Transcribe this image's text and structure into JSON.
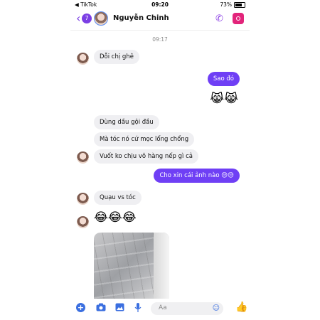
{
  "status_bar": {
    "carrier": "◀ TikTok",
    "time": "09:20",
    "battery": "73%"
  },
  "header": {
    "unread_count": "7",
    "name": "Nguyễn Chinh"
  },
  "timestamp": "09:17",
  "messages": {
    "m1": "Dỗi chị ghê",
    "m2": "Sao đó",
    "m3": "😹😹",
    "m4": "Dùng dầu gội đầu",
    "m5": "Mà tóc nó cứ  mọc lổng chổng",
    "m6": "Vuốt ko chịu vô hàng nếp gì cả",
    "m7": "Cho xin cái ảnh nào 😒😒",
    "m8": "Quạu vs tóc",
    "m9": "😂😂😂"
  },
  "composer": {
    "placeholder": "Aa"
  },
  "colors": {
    "accent": "#6f3ff5",
    "toolbar_icons": "#3b6fe0",
    "incoming_bubble": "#efeff2"
  }
}
